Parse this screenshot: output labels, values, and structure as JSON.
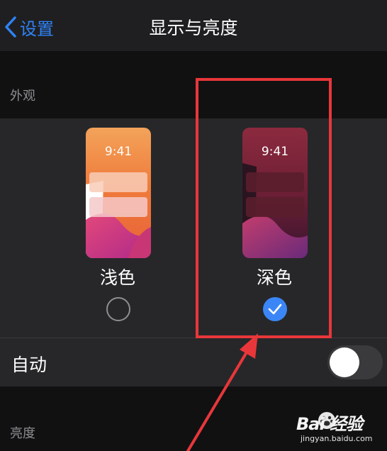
{
  "nav": {
    "back_label": "设置",
    "title": "显示与亮度"
  },
  "sections": {
    "appearance": "外观",
    "brightness": "亮度"
  },
  "appearance": {
    "light": {
      "label": "浅色",
      "time": "9:41",
      "selected": false
    },
    "dark": {
      "label": "深色",
      "time": "9:41",
      "selected": true
    }
  },
  "automatic": {
    "label": "自动",
    "enabled": false
  },
  "watermark": {
    "brand": "Bai 经验",
    "url": "jingyan.baidu.com"
  },
  "icons": {
    "back": "chevron-left-icon",
    "check": "checkmark-icon",
    "paw": "paw-icon"
  },
  "colors": {
    "accent": "#2f83f7",
    "selected_radio": "#3b86f6",
    "highlight": "#e8373a",
    "background": "#1c1c1e",
    "card": "#272729"
  }
}
